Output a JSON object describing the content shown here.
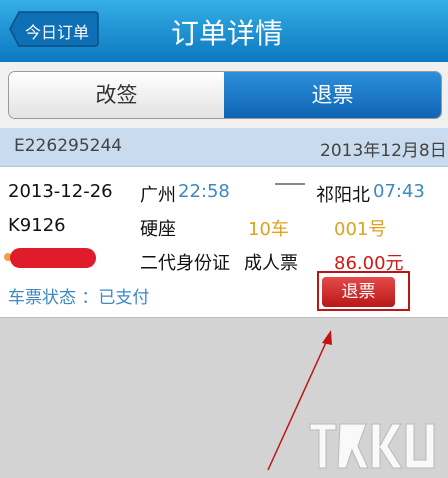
{
  "header": {
    "back_label": "今日订单",
    "title": "订单详情",
    "bg_color": "#1a8ad0"
  },
  "tabs": [
    {
      "label": "改签",
      "active": false
    },
    {
      "label": "退票",
      "active": true
    }
  ],
  "order": {
    "id": "E226295244",
    "date": "2013年12月8日"
  },
  "ticket": {
    "travel_date": "2013-12-26",
    "from_station": "广州",
    "depart_time": "22:58",
    "to_station": "祁阳北",
    "arrive_time": "07:43",
    "train_no": "K9126",
    "seat_class": "硬座",
    "car": "10车",
    "seat_no": "001号",
    "id_type": "二代身份证",
    "ticket_type": "成人票",
    "price": "86.00元",
    "status": "车票状态 ：已支付",
    "refund_button": "退票"
  },
  "colors": {
    "accent_blue": "#3a8ac4",
    "orange": "#e0a020",
    "red": "#d01818"
  }
}
